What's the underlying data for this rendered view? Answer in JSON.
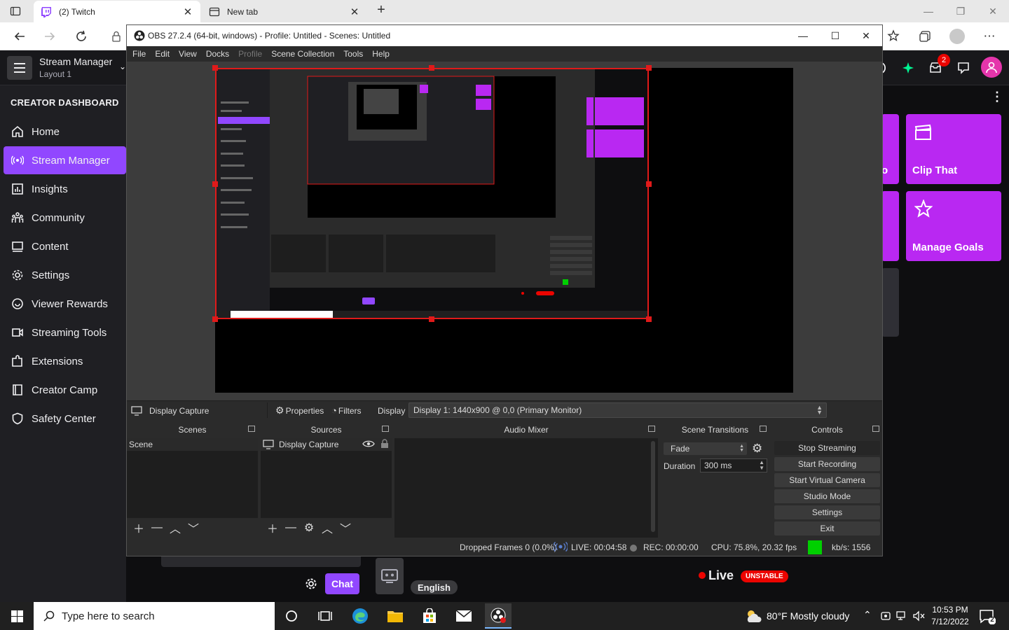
{
  "browser": {
    "tabs": [
      {
        "title": "(2) Twitch",
        "active": true
      },
      {
        "title": "New tab",
        "active": false
      }
    ],
    "new_tab_symbol": "+",
    "window_controls": {
      "minimize": "—",
      "restore": "❐",
      "close": "✕"
    }
  },
  "twitch": {
    "stream_manager_title": "Stream Manager",
    "layout_label": "Layout 1",
    "sidebar_heading": "CREATOR DASHBOARD",
    "sidebar_items": [
      {
        "label": "Home",
        "icon": "home-icon",
        "active": false
      },
      {
        "label": "Stream Manager",
        "icon": "broadcast-icon",
        "active": true
      },
      {
        "label": "Insights",
        "icon": "chart-icon",
        "active": false
      },
      {
        "label": "Community",
        "icon": "community-icon",
        "active": false
      },
      {
        "label": "Content",
        "icon": "content-icon",
        "active": false
      },
      {
        "label": "Settings",
        "icon": "gear-icon",
        "active": false
      },
      {
        "label": "Viewer Rewards",
        "icon": "rewards-icon",
        "active": false
      },
      {
        "label": "Streaming Tools",
        "icon": "camera-icon",
        "active": false
      },
      {
        "label": "Extensions",
        "icon": "extensions-icon",
        "active": false
      },
      {
        "label": "Creator Camp",
        "icon": "book-icon",
        "active": false
      },
      {
        "label": "Safety Center",
        "icon": "shield-icon",
        "active": false
      }
    ],
    "notification_count": "2",
    "quick_actions": {
      "clip_that": "Clip That",
      "manage_goals": "Manage Goals",
      "partial_label": "o"
    },
    "chat_button": "Chat",
    "language_tag": "English",
    "live_label": "Live",
    "health_badge": "UNSTABLE",
    "accent": "#9147ff",
    "tile_color": "#b928f2"
  },
  "obs": {
    "title": "OBS 27.2.4 (64-bit, windows) - Profile: Untitled - Scenes: Untitled",
    "menu": [
      {
        "label": "File",
        "enabled": true
      },
      {
        "label": "Edit",
        "enabled": true
      },
      {
        "label": "View",
        "enabled": true
      },
      {
        "label": "Docks",
        "enabled": true
      },
      {
        "label": "Profile",
        "enabled": false
      },
      {
        "label": "Scene Collection",
        "enabled": true
      },
      {
        "label": "Tools",
        "enabled": true
      },
      {
        "label": "Help",
        "enabled": true
      }
    ],
    "source_toolbar": {
      "selected_source": "Display Capture",
      "properties": "Properties",
      "filters": "Filters",
      "display_label": "Display",
      "display_value": "Display 1: 1440x900 @ 0,0 (Primary Monitor)"
    },
    "docks": {
      "scenes": {
        "title": "Scenes",
        "items": [
          "Scene"
        ]
      },
      "sources": {
        "title": "Sources",
        "items": [
          "Display Capture"
        ]
      },
      "audio_mixer": {
        "title": "Audio Mixer"
      },
      "transitions": {
        "title": "Scene Transitions",
        "transition": "Fade",
        "duration_label": "Duration",
        "duration_value": "300 ms"
      },
      "controls": {
        "title": "Controls",
        "buttons": [
          "Stop Streaming",
          "Start Recording",
          "Start Virtual Camera",
          "Studio Mode",
          "Settings",
          "Exit"
        ]
      }
    },
    "status": {
      "dropped_frames": "Dropped Frames 0 (0.0%)",
      "live": "LIVE: 00:04:58",
      "rec": "REC: 00:00:00",
      "cpu": "CPU: 75.8%, 20.32 fps",
      "kbps": "kb/s: 1556",
      "bitrate_ok_color": "#00d000"
    }
  },
  "taskbar": {
    "search_placeholder": "Type here to search",
    "weather": "80°F  Mostly cloudy",
    "time": "10:53 PM",
    "date": "7/12/2022",
    "notifications": "2"
  }
}
